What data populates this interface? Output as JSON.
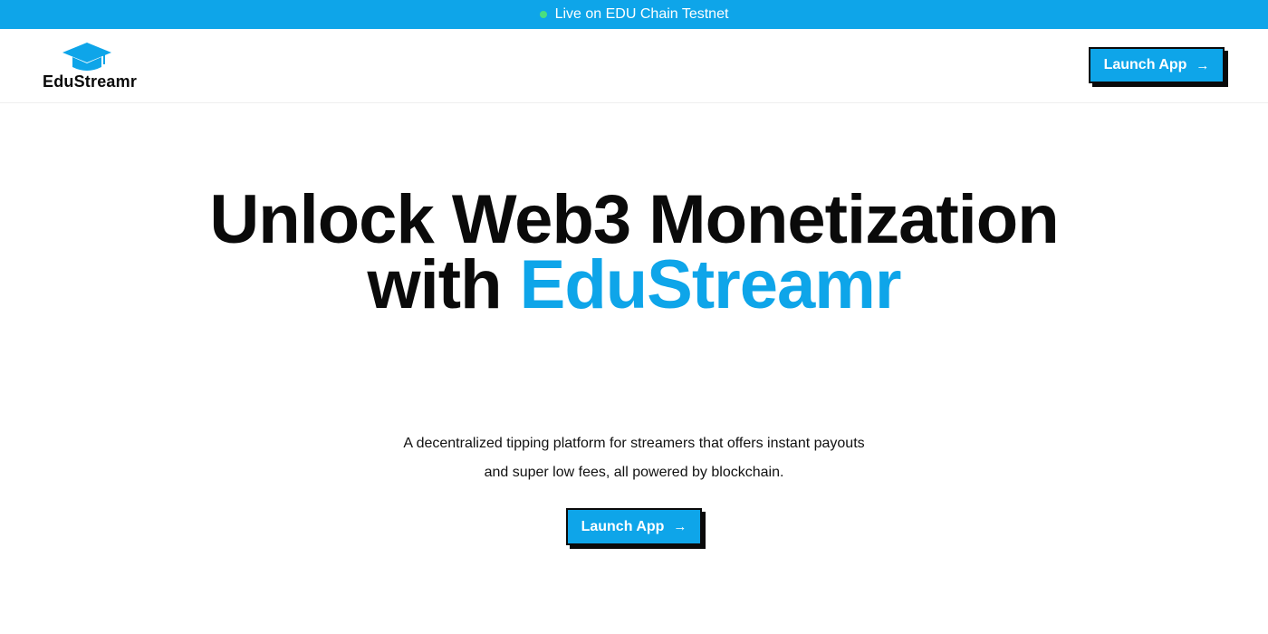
{
  "banner": {
    "text": "Live on EDU Chain Testnet",
    "dot_color": "#4ade80"
  },
  "header": {
    "logo_text": "EduStreamr",
    "logo_icon": "graduation-cap-icon",
    "launch_label": "Launch App",
    "launch_icon": "arrow-right-icon"
  },
  "hero": {
    "headline_line1": "Unlock Web3 Monetization",
    "headline_prefix": "with",
    "headline_accent": "EduStreamr",
    "description_line1": "A decentralized tipping platform for streamers that offers instant payouts",
    "description_line2": "and super low fees, all powered by blockchain.",
    "cta_label": "Launch App"
  },
  "colors": {
    "accent": "#0ea5e9",
    "text": "#0a0a0a",
    "background": "#ffffff"
  }
}
